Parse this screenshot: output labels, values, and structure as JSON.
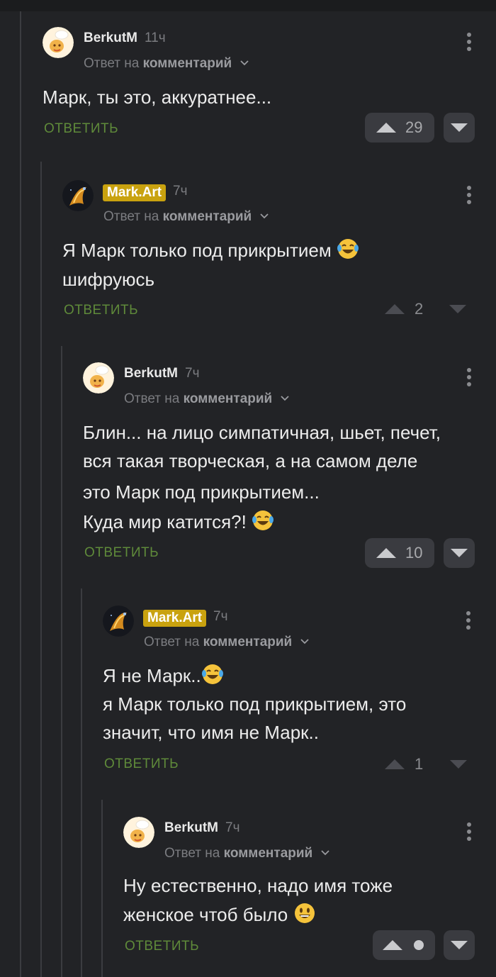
{
  "common": {
    "reply_prefix": "Ответ на",
    "reply_target": "комментарий",
    "reply_action": "ОТВЕТИТЬ"
  },
  "comments": [
    {
      "author": "BerkutM",
      "time": "11ч",
      "lines": [
        "Марк, ты это, аккуратнее..."
      ],
      "rating": "29"
    },
    {
      "author": "Mark.Art",
      "time": "7ч",
      "lines": [
        "Я Марк только под прикрытием",
        "шифруюсь"
      ],
      "rating": "2"
    },
    {
      "author": "BerkutM",
      "time": "7ч",
      "lines": [
        "Блин... на лицо симпатичная, шьет, печет,",
        "вся такая творческая, а на самом деле",
        "это Марк под прикрытием...",
        "Куда мир катится?!"
      ],
      "rating": "10"
    },
    {
      "author": "Mark.Art",
      "time": "7ч",
      "lines": [
        "Я не Марк..",
        "я Марк только под прикрытием, это",
        "значит, что имя не Марк.."
      ],
      "rating": "1"
    },
    {
      "author": "BerkutM",
      "time": "7ч",
      "lines": [
        "Ну естественно, надо имя тоже",
        "женское чтоб было"
      ],
      "rating": ""
    }
  ],
  "icons": {
    "emoji_laugh": "laughing-with-tears-icon",
    "emoji_smile": "grinning-face-icon",
    "upvote": "arrow-up-icon",
    "downvote": "arrow-down-icon",
    "menu": "more-vertical-icon",
    "avatar_berkut": "avatar-cook-icon",
    "avatar_mark": "avatar-galaxy-icon"
  },
  "colors": {
    "background": "#222326",
    "reply_link": "#5f8a3a",
    "badge": "#c9a20f",
    "vote_box": "#3a3b40"
  }
}
